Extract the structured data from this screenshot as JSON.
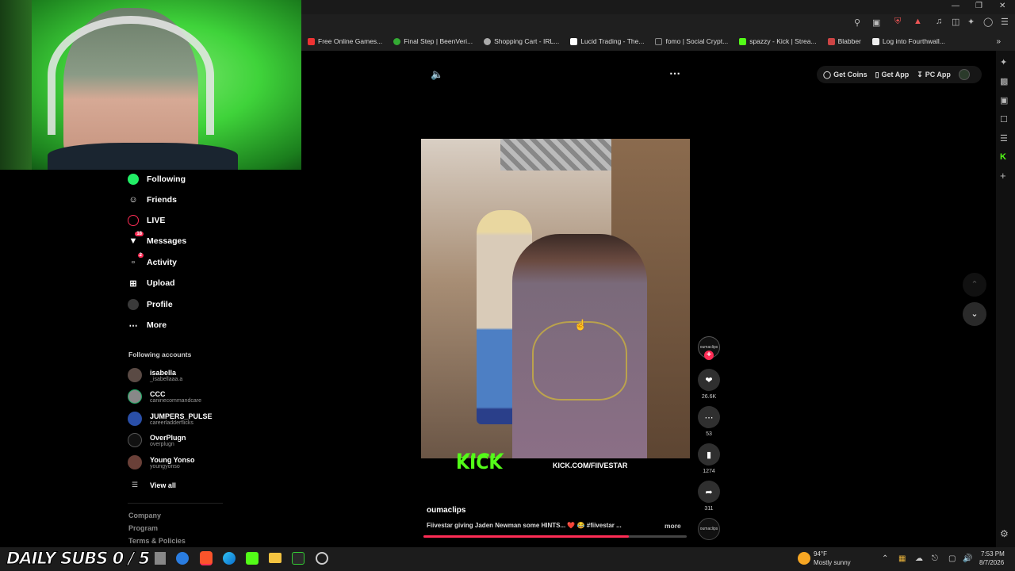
{
  "browser": {
    "bookmarks": [
      {
        "label": "Free Online Games...",
        "color": "#e33"
      },
      {
        "label": "Final Step | BeenVeri...",
        "color": "#3a3"
      },
      {
        "label": "Shopping Cart - IRL...",
        "color": "#aaa"
      },
      {
        "label": "Lucid Trading - The...",
        "color": "#fff"
      },
      {
        "label": "fomo | Social Crypt...",
        "color": "#222"
      },
      {
        "label": "spazzy - Kick | Strea...",
        "color": "#53fc18"
      },
      {
        "label": "Blabber",
        "color": "#c44"
      },
      {
        "label": "Log into Fourthwall...",
        "color": "#eee"
      }
    ]
  },
  "header": {
    "get_coins": "Get Coins",
    "get_app": "Get App",
    "pc_app": "PC App"
  },
  "sidebar": {
    "nav": [
      {
        "label": "Following",
        "icon": "following-icon"
      },
      {
        "label": "Friends",
        "icon": "friends-icon"
      },
      {
        "label": "LIVE",
        "icon": "live-icon"
      },
      {
        "label": "Messages",
        "icon": "messages-icon",
        "badge": "18"
      },
      {
        "label": "Activity",
        "icon": "activity-icon",
        "badge": "2"
      },
      {
        "label": "Upload",
        "icon": "upload-icon"
      },
      {
        "label": "Profile",
        "icon": "profile-icon"
      },
      {
        "label": "More",
        "icon": "more-icon"
      }
    ],
    "following_heading": "Following accounts",
    "accounts": [
      {
        "name": "isabella",
        "handle": "_isabellaaa.a"
      },
      {
        "name": "CCC",
        "handle": "caninecommandcare"
      },
      {
        "name": "JUMPERS_PULSE",
        "handle": "careerladderflicks"
      },
      {
        "name": "OverPlugn",
        "handle": "overplugn"
      },
      {
        "name": "Young Yonso",
        "handle": "youngyonso"
      }
    ],
    "view_all": "View all",
    "footer": [
      "Company",
      "Program",
      "Terms & Policies"
    ]
  },
  "video": {
    "watermark_brand": "KICK",
    "watermark_url": "KICK.COM/FIIVESTAR",
    "author": "oumaclips",
    "caption": "Fiivestar giving Jaden Newman some HINTS... ❤️ 😂 #fiivestar ...",
    "more": "more",
    "progress": 0.78
  },
  "actions": {
    "avatar_label": "oumaclips",
    "likes": "26.6K",
    "comments": "53",
    "saves": "1274",
    "shares": "311",
    "music_label": "oumaclips"
  },
  "overlay": {
    "subs": "DAILY SUBS 0 / 5"
  },
  "taskbar": {
    "temp": "94°F",
    "weather": "Mostly sunny",
    "time": "7:53 PM",
    "date": "8/7/2026"
  },
  "colors": {
    "accent": "#fe2c55",
    "kick_green": "#53fc18"
  }
}
